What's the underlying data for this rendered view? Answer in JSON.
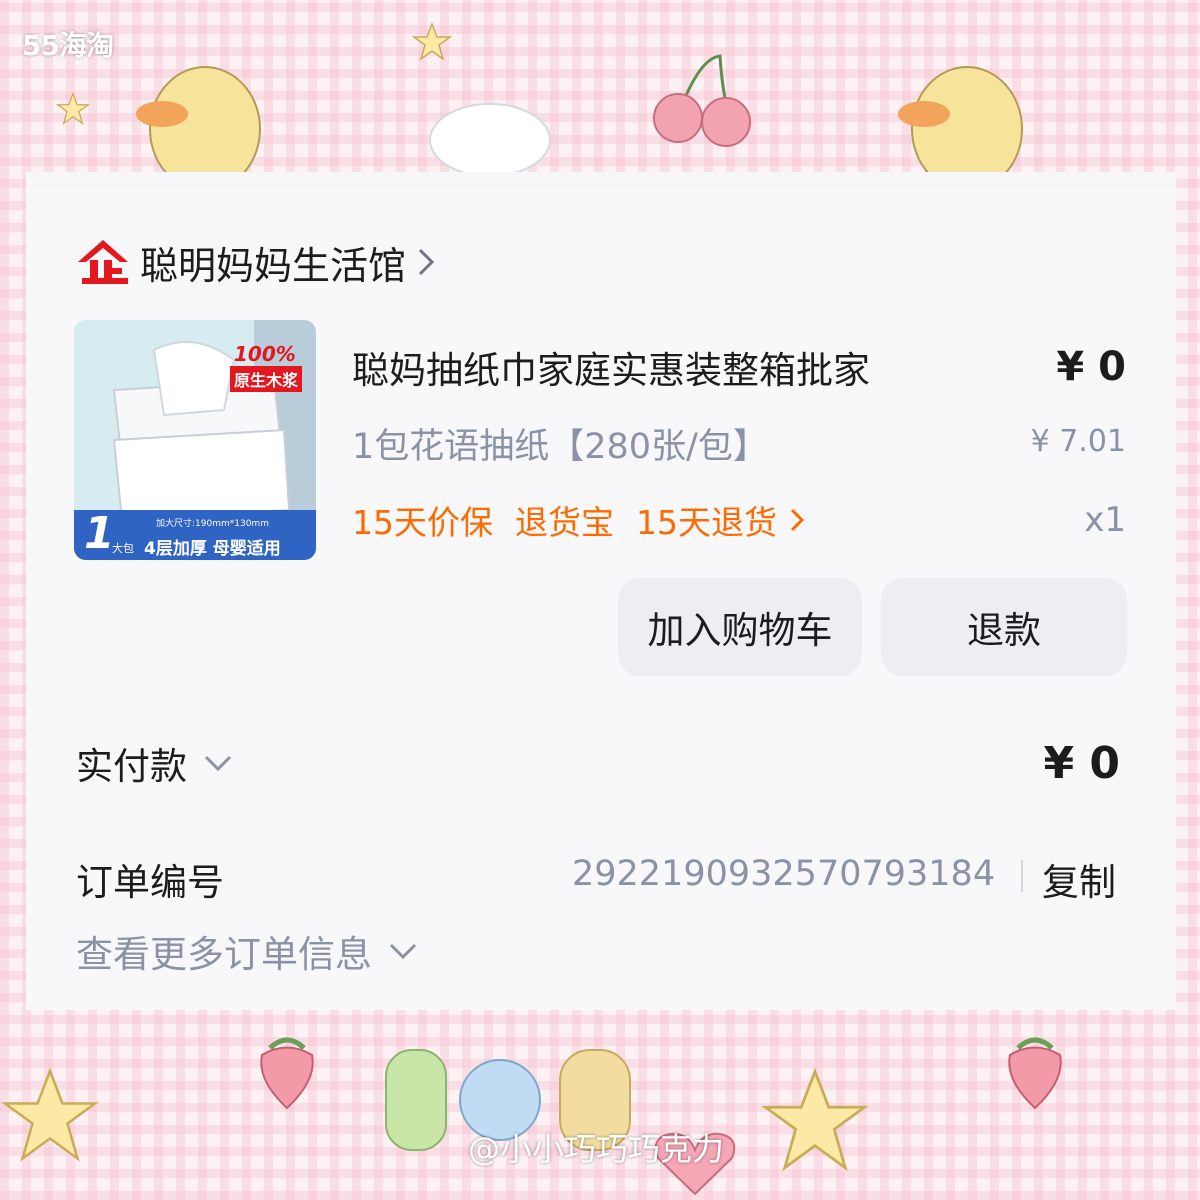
{
  "watermarks": {
    "top": "55海淘",
    "bottom": "@小小巧巧巧克力"
  },
  "shop": {
    "icon": "tmall-enterprise-icon",
    "name": "聪明妈妈生活馆"
  },
  "product": {
    "title": "聪妈抽纸巾家庭实惠装整箱批家",
    "price": "¥ 0",
    "spec": "1包花语抽纸【280张/包】",
    "original_price": "¥ 7.01",
    "quantity": "x1",
    "tags": [
      "15天价保",
      "退货宝",
      "15天退货"
    ],
    "thumbnail": {
      "badge_top": "100%",
      "badge_bottom": "原生木浆",
      "size_note": "加大尺寸:190mm*130mm",
      "count_number": "1",
      "count_unit": "大包",
      "banner": "4层加厚 母婴适用"
    }
  },
  "actions": {
    "add_to_cart": "加入购物车",
    "refund": "退款"
  },
  "payment": {
    "label": "实付款",
    "value": "¥ 0"
  },
  "order": {
    "label": "订单编号",
    "number": "2922190932570793184",
    "copy": "复制",
    "more_info": "查看更多订单信息"
  },
  "colors": {
    "accent_orange": "#ff6a00",
    "shop_icon_red": "#e4161e",
    "muted_text": "#8a93a6"
  }
}
